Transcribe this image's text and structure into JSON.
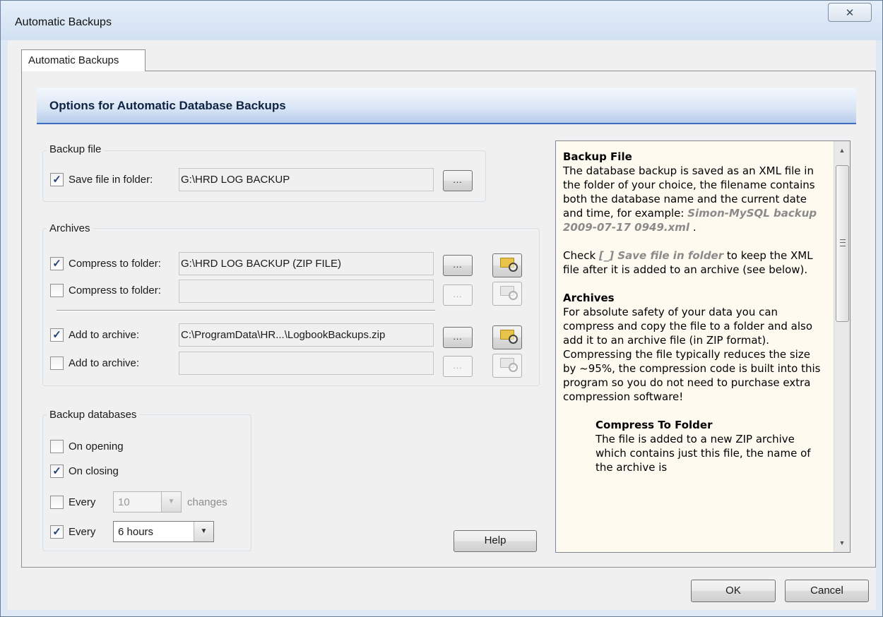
{
  "window": {
    "title": "Automatic Backups",
    "close_glyph": "✕"
  },
  "tab": {
    "label": "Automatic Backups"
  },
  "header": {
    "title": "Options for Automatic Database Backups"
  },
  "backup_file": {
    "group_title": "Backup file",
    "save_label": "Save file in folder:",
    "save_checked": "✓",
    "save_path": "G:\\HRD LOG BACKUP",
    "browse_label": "..."
  },
  "archives": {
    "group_title": "Archives",
    "rows": [
      {
        "label": "Compress to folder:",
        "check": "✓",
        "path": "G:\\HRD LOG BACKUP (ZIP FILE)",
        "dots": "..."
      },
      {
        "label": "Compress to folder:",
        "check": "",
        "path": "",
        "dots": "..."
      },
      {
        "label": "Add to archive:",
        "check": "✓",
        "path": "C:\\ProgramData\\HR...\\LogbookBackups.zip",
        "dots": "..."
      },
      {
        "label": "Add to archive:",
        "check": "",
        "path": "",
        "dots": "..."
      }
    ]
  },
  "backup_databases": {
    "group_title": "Backup databases",
    "on_opening": {
      "label": "On opening",
      "check": ""
    },
    "on_closing": {
      "label": "On closing",
      "check": "✓"
    },
    "every_changes": {
      "label": "Every",
      "check": "",
      "value": "10",
      "suffix": "changes"
    },
    "every_hours": {
      "label": "Every",
      "check": "✓",
      "value": "6 hours"
    }
  },
  "buttons": {
    "help": "Help",
    "ok": "OK",
    "cancel": "Cancel"
  },
  "help": {
    "backup_file_title": "Backup File",
    "backup_file_text": "The database backup is saved as an XML file in the folder of your choice, the filename contains both the database name and the current date and time, for example: ",
    "backup_file_example": "Simon-MySQL backup 2009-07-17 0949.xml",
    "backup_file_end": " .",
    "check_prefix": "Check ",
    "check_code": "[_] Save file in folder",
    "check_suffix": " to keep the XML file after it is added to an archive (see below).",
    "archives_title": "Archives",
    "archives_text": "For absolute safety of your data you can compress and copy the file to a folder and also add it to an archive file (in ZIP format). Compressing the file typically reduces the size by ~95%, the compression code is built into this program so you do not need to purchase extra compression software!",
    "compress_title": "Compress To Folder",
    "compress_text": "The file is added to a new ZIP archive which contains just this file, the name of the archive is"
  },
  "icons": {
    "browse": "folder-search-icon",
    "scroll_up": "▲",
    "scroll_down": "▼",
    "dropdown": "▼"
  }
}
